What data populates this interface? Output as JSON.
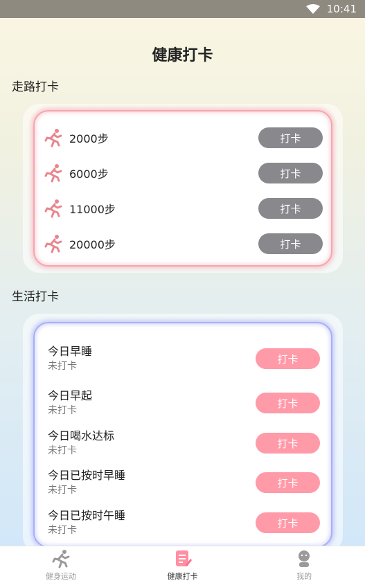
{
  "status_bar": {
    "time": "10:41"
  },
  "page": {
    "title": "健康打卡"
  },
  "walk_section": {
    "title": "走路打卡",
    "items": [
      {
        "label": "2000步",
        "button": "打卡"
      },
      {
        "label": "6000步",
        "button": "打卡"
      },
      {
        "label": "11000步",
        "button": "打卡"
      },
      {
        "label": "20000步",
        "button": "打卡"
      }
    ]
  },
  "life_section": {
    "title": "生活打卡",
    "items": [
      {
        "label": "今日早睡",
        "status": "未打卡",
        "button": "打卡"
      },
      {
        "label": "今日早起",
        "status": "未打卡",
        "button": "打卡"
      },
      {
        "label": "今日喝水达标",
        "status": "未打卡",
        "button": "打卡"
      },
      {
        "label": "今日已按时早睡",
        "status": "未打卡",
        "button": "打卡"
      },
      {
        "label": "今日已按时午睡",
        "status": "未打卡",
        "button": "打卡"
      }
    ]
  },
  "tab_bar": {
    "tabs": [
      {
        "label": "健身运动",
        "icon": "running-man-icon"
      },
      {
        "label": "健康打卡",
        "icon": "checklist-icon",
        "active": true
      },
      {
        "label": "我的",
        "icon": "profile-icon"
      }
    ]
  },
  "colors": {
    "walk_accent": "#f4a6b0",
    "life_accent": "#a8aef8",
    "button_gray": "#88888d",
    "button_pink": "#ff9aa8",
    "run_icon": "#e8868e"
  }
}
